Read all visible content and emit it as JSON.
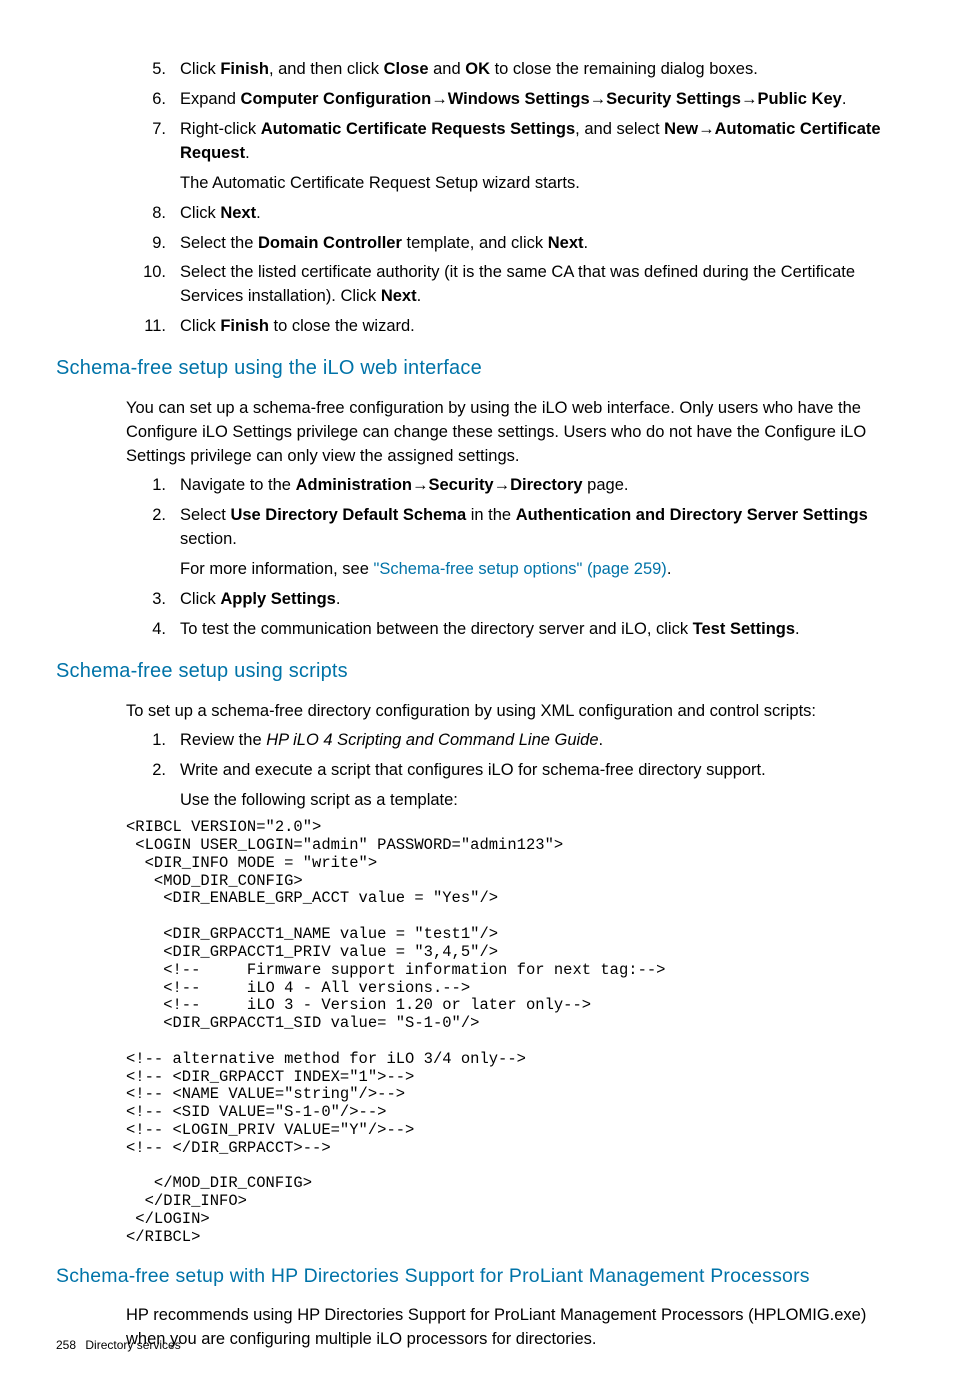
{
  "steps_a": [
    {
      "num": "5.",
      "html": "Click <b>Finish</b>, and then click <b>Close</b> and <b>OK</b> to close the remaining dialog boxes."
    },
    {
      "num": "6.",
      "html": "Expand <b>Computer Configuration</b>→<b>Windows Settings</b>→<b>Security Settings</b>→<b>Public Key</b>."
    },
    {
      "num": "7.",
      "html": "Right-click <b>Automatic Certificate Requests Settings</b>, and select <b>New</b>→<b>Automatic Certificate Request</b>."
    }
  ],
  "sub_a": "The Automatic Certificate Request Setup wizard starts.",
  "steps_b": [
    {
      "num": "8.",
      "html": "Click <b>Next</b>."
    },
    {
      "num": "9.",
      "html": "Select the <b>Domain Controller</b> template, and click <b>Next</b>."
    },
    {
      "num": "10.",
      "html": "Select the listed certificate authority (it is the same CA that was defined during the Certificate Services installation). Click <b>Next</b>."
    },
    {
      "num": "11.",
      "html": "Click <b>Finish</b> to close the wizard."
    }
  ],
  "h2_web": "Schema-free setup using the iLO web interface",
  "p_web": "You can set up a schema-free configuration by using the iLO web interface. Only users who have the Configure iLO Settings privilege can change these settings. Users who do not have the Configure iLO Settings privilege can only view the assigned settings.",
  "steps_web": [
    {
      "num": "1.",
      "html": "Navigate to the <b>Administration</b>→<b>Security</b>→<b>Directory</b> page."
    },
    {
      "num": "2.",
      "html": "Select <b>Use Directory Default Schema</b> in the <b>Authentication and Directory Server Settings</b> section."
    }
  ],
  "sub_web_pre": "For more information, see ",
  "sub_web_link": "\"Schema-free setup options\" (page 259)",
  "sub_web_post": ".",
  "steps_web2": [
    {
      "num": "3.",
      "html": "Click <b>Apply Settings</b>."
    },
    {
      "num": "4.",
      "html": "To test the communication between the directory server and iLO, click <b>Test Settings</b>."
    }
  ],
  "h2_scripts": "Schema-free setup using scripts",
  "p_scripts": "To set up a schema-free directory configuration by using XML configuration and control scripts:",
  "steps_scripts": [
    {
      "num": "1.",
      "html": "Review the <i>HP iLO 4 Scripting and Command Line Guide</i>."
    },
    {
      "num": "2.",
      "html": "Write and execute a script that configures iLO for schema-free directory support."
    }
  ],
  "sub_scripts": "Use the following script as a template:",
  "code": "<RIBCL VERSION=\"2.0\">\n <LOGIN USER_LOGIN=\"admin\" PASSWORD=\"admin123\">\n  <DIR_INFO MODE = \"write\">\n   <MOD_DIR_CONFIG>\n    <DIR_ENABLE_GRP_ACCT value = \"Yes\"/>\n\n    <DIR_GRPACCT1_NAME value = \"test1\"/>\n    <DIR_GRPACCT1_PRIV value = \"3,4,5\"/>\n    <!--     Firmware support information for next tag:-->\n    <!--     iLO 4 - All versions.-->\n    <!--     iLO 3 - Version 1.20 or later only-->\n    <DIR_GRPACCT1_SID value= \"S-1-0\"/>\n\n<!-- alternative method for iLO 3/4 only-->\n<!-- <DIR_GRPACCT INDEX=\"1\">-->\n<!-- <NAME VALUE=\"string\"/>-->\n<!-- <SID VALUE=\"S-1-0\"/>-->\n<!-- <LOGIN_PRIV VALUE=\"Y\"/>-->\n<!-- </DIR_GRPACCT>-->\n\n   </MOD_DIR_CONFIG>\n  </DIR_INFO>\n </LOGIN>\n</RIBCL>",
  "h2_hp": "Schema-free setup with HP Directories Support for ProLiant Management Processors",
  "p_hp": "HP recommends using HP Directories Support for ProLiant Management Processors (HPLOMIG.exe) when you are configuring multiple iLO processors for directories.",
  "footer_page": "258",
  "footer_section": "Directory services"
}
